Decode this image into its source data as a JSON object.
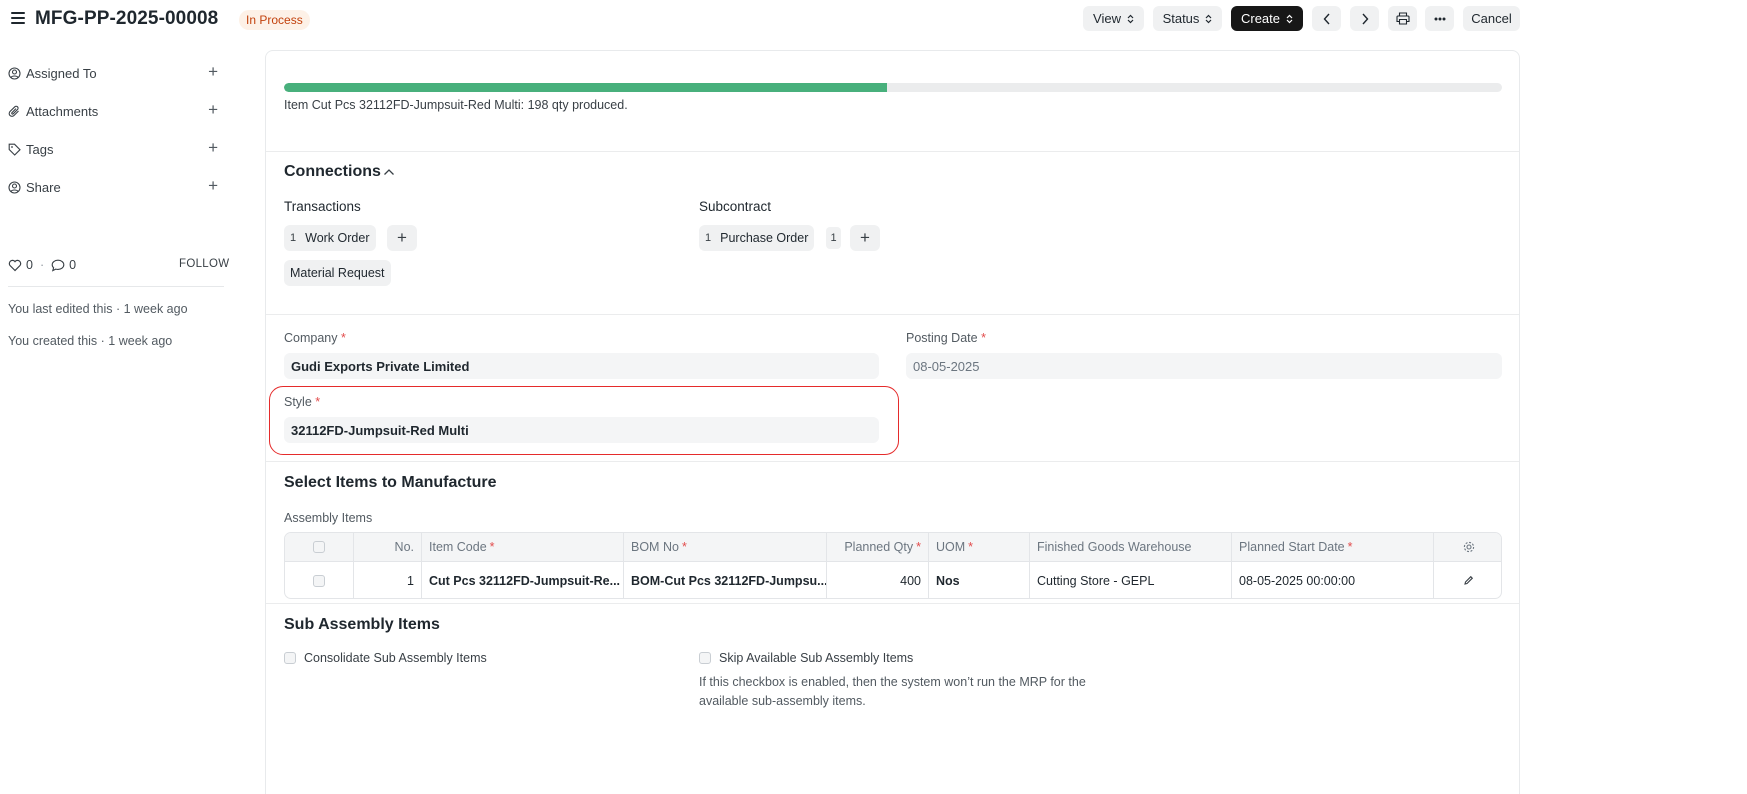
{
  "header": {
    "title": "MFG-PP-2025-00008",
    "status": "In Process",
    "buttons": {
      "view": "View",
      "status": "Status",
      "create": "Create",
      "cancel": "Cancel"
    }
  },
  "sidebar": {
    "items": [
      {
        "label": "Assigned To",
        "icon": "user-assign-icon"
      },
      {
        "label": "Attachments",
        "icon": "paperclip-icon"
      },
      {
        "label": "Tags",
        "icon": "tag-icon"
      },
      {
        "label": "Share",
        "icon": "share-user-icon"
      }
    ],
    "likes": "0",
    "comments": "0",
    "follow": "FOLLOW",
    "last_edited": "You last edited this · 1 week ago",
    "created": "You created this · 1 week ago"
  },
  "progress": {
    "fraction": 0.495,
    "color": "#48b07c",
    "text": "Item Cut Pcs 32112FD-Jumpsuit-Red Multi: 198 qty produced."
  },
  "connections": {
    "title": "Connections",
    "transactions": {
      "title": "Transactions",
      "work_order_count": "1",
      "work_order_label": "Work Order",
      "material_request_label": "Material Request"
    },
    "subcontract": {
      "title": "Subcontract",
      "purchase_order_count": "1",
      "purchase_order_label": "Purchase Order",
      "extra_count": "1"
    }
  },
  "form": {
    "company_label": "Company",
    "company_value": "Gudi Exports Private Limited",
    "posting_date_label": "Posting Date",
    "posting_date_value": "08-05-2025",
    "style_label": "Style",
    "style_value": "32112FD-Jumpsuit-Red Multi",
    "required_mark": "*"
  },
  "manufacture": {
    "title": "Select Items to Manufacture",
    "assembly_label": "Assembly Items",
    "columns": [
      "No.",
      "Item Code",
      "BOM No",
      "Planned Qty",
      "UOM",
      "Finished Goods Warehouse",
      "Planned Start Date"
    ],
    "rows": [
      {
        "no": "1",
        "item_code": "Cut Pcs 32112FD-Jumpsuit-Re...",
        "bom_no": "BOM-Cut Pcs 32112FD-Jumpsu...",
        "planned_qty": "400",
        "uom": "Nos",
        "warehouse": "Cutting Store - GEPL",
        "start_date": "08-05-2025 00:00:00"
      }
    ]
  },
  "sub_assembly": {
    "title": "Sub Assembly Items",
    "consolidate_label": "Consolidate Sub Assembly Items",
    "skip_label": "Skip Available Sub Assembly Items",
    "skip_description": "If this checkbox is enabled, then the system won’t run the MRP for the available sub-assembly items."
  }
}
